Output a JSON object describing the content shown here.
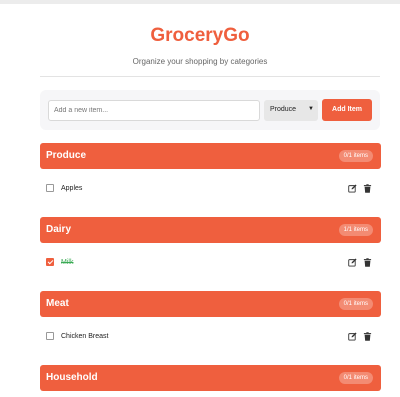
{
  "app": {
    "title": "GroceryGo",
    "subtitle": "Organize your shopping by categories"
  },
  "add_form": {
    "input_placeholder": "Add a new item...",
    "input_value": "",
    "selected_category": "Produce",
    "add_button_label": "Add Item"
  },
  "categories": [
    {
      "name": "Produce",
      "badge": "0/1 items",
      "items": [
        {
          "label": "Apples",
          "checked": false
        }
      ]
    },
    {
      "name": "Dairy",
      "badge": "1/1 items",
      "items": [
        {
          "label": "Milk",
          "checked": true
        }
      ]
    },
    {
      "name": "Meat",
      "badge": "0/1 items",
      "items": [
        {
          "label": "Chicken Breast",
          "checked": false
        }
      ]
    },
    {
      "name": "Household",
      "badge": "0/1 items",
      "items": []
    }
  ],
  "colors": {
    "accent": "#ef5f3e",
    "completed_text": "#3aaa54"
  },
  "icons": {
    "edit": "edit-icon",
    "delete": "trash-icon",
    "dropdown": "chevron-down-icon"
  }
}
